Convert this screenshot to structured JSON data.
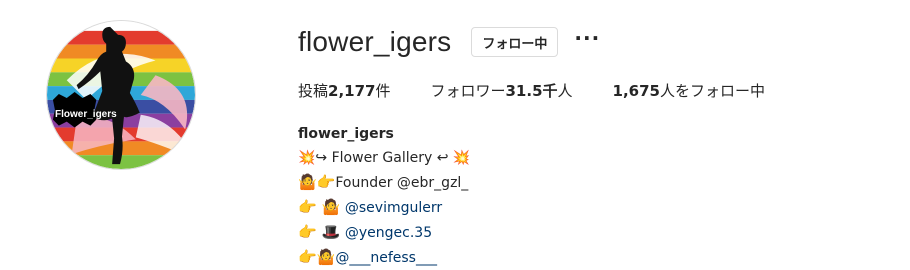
{
  "profile": {
    "avatar_logo_text": "Flower_igers",
    "username": "flower_igers",
    "follow_button_label": "フォロー中",
    "more_label": "···"
  },
  "stats": {
    "posts_label": "投稿",
    "posts_value": "2,177",
    "posts_unit": "件",
    "followers_label": "フォロワー",
    "followers_value": "31.5千",
    "followers_unit": "人",
    "following_value": "1,675",
    "following_label": "人をフォロー中"
  },
  "bio": {
    "name": "flower_igers",
    "line1": "💥↪ Flower Gallery ↩ 💥",
    "line2_emoji": "🤷👉",
    "line2_text": "Founder @ebr_gzl_",
    "line3_emoji": "👉 🤷 ",
    "line3_text": "@sevimgulerr",
    "line4_emoji": "👉 🎩 ",
    "line4_text": "@yengec.35",
    "line5_emoji": "👉🤷",
    "line5_text": "@___nefess___"
  },
  "colors": {
    "text": "#262626",
    "border": "#dbdbdb",
    "mention": "#00376b"
  }
}
